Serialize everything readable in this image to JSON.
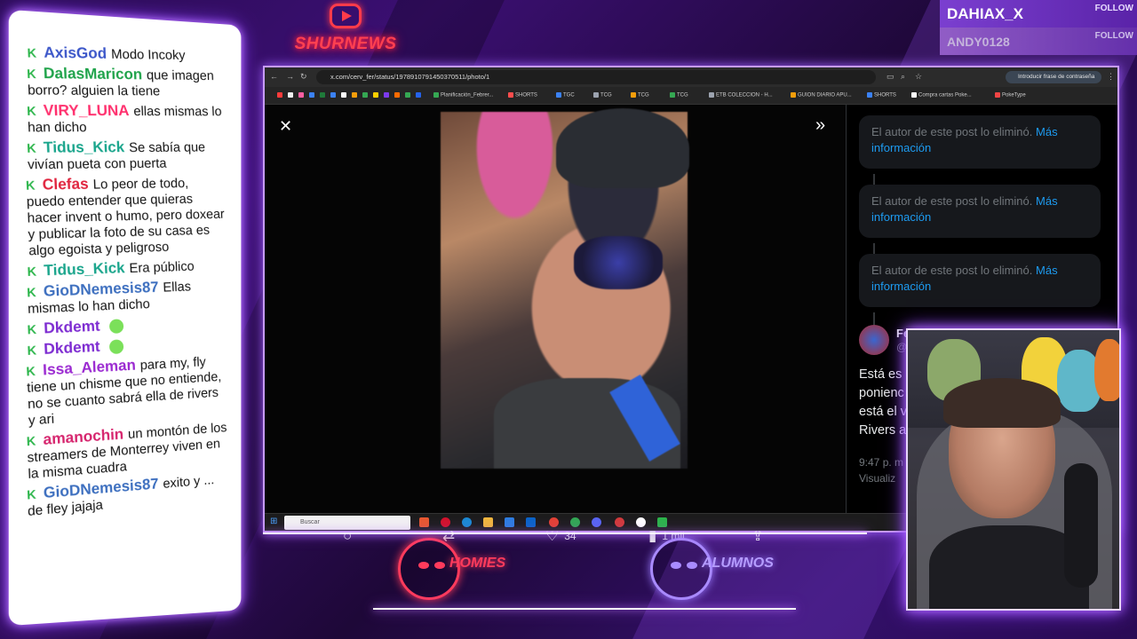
{
  "chat": {
    "messages": [
      {
        "user": "AxisGod",
        "color": "#3b56c9",
        "text": "Modo Incoky"
      },
      {
        "user": "DalasMaricon",
        "color": "#1fa34a",
        "text": "que imagen borro? alguien la tiene"
      },
      {
        "user": "VIRY_LUNA",
        "color": "#ff2f6d",
        "text": "ellas mismas lo han dicho"
      },
      {
        "user": "Tidus_Kick",
        "color": "#1aa58c",
        "text": "Se sabía que vivían pueta con puerta"
      },
      {
        "user": "Clefas",
        "color": "#e0243e",
        "text": "Lo peor de todo, puedo entender que quieras hacer invent o humo, pero doxear y publicar la foto de su casa es algo egoista y peligroso"
      },
      {
        "user": "Tidus_Kick",
        "color": "#1aa58c",
        "text": "Era público"
      },
      {
        "user": "GioDNemesis87",
        "color": "#3d6fbf",
        "text": "Ellas mismas lo han dicho"
      },
      {
        "user": "Dkdemt",
        "color": "#7d2bd1",
        "text": ""
      },
      {
        "user": "Dkdemt",
        "color": "#7d2bd1",
        "text": ""
      },
      {
        "user": "Issa_Aleman",
        "color": "#9b2ad1",
        "text": "para my, fly tiene un chisme que no entiende, no se cuanto sabrá ella de rivers y ari"
      },
      {
        "user": "amanochin",
        "color": "#d6246d",
        "text": "un montón de los streamers de Monterrey viven en la misma cuadra"
      },
      {
        "user": "GioDNemesis87",
        "color": "#3d6fbf",
        "text": "exito y ... de fley jajaja"
      }
    ],
    "kick_icon": "K"
  },
  "logo_top": {
    "text": "SHURNEWS",
    "icon": "youtube-play-icon"
  },
  "follows": [
    {
      "name": "DAHIAX_X",
      "tag": "FOLLOW"
    },
    {
      "name": "ANDY0128",
      "tag": "FOLLOW"
    }
  ],
  "browser": {
    "url": "x.com/cerv_fer/status/1978910791450370511/photo/1",
    "password_chip": "Introducir frase de contraseña",
    "bookmarks": [
      "Planificación_Febrer...",
      "SHORTS",
      "TGC",
      "TCG",
      "TCG",
      "TCG",
      "ETB COLECCION - H...",
      "GUION DIARIO APU...",
      "SHORTS",
      "Compra cartas Poke...",
      "PokeType"
    ]
  },
  "viewer": {
    "close_glyph": "✕",
    "expand_glyph": "»",
    "actions": {
      "reply_count": "",
      "retweet_count": "",
      "like_count": "34",
      "views_count": "1 mil"
    }
  },
  "side": {
    "deleted_notices": [
      {
        "text": "El autor de este post lo eliminó.",
        "more": "Más información"
      },
      {
        "text": "El autor de este post lo eliminó.",
        "more": "Más información"
      },
      {
        "text": "El autor de este post lo eliminó.",
        "more": "Más información"
      }
    ],
    "post": {
      "name": "Fe",
      "handle": "@",
      "text_lines": [
        "Está es l",
        "ponienc",
        "está el v",
        "Rivers a"
      ],
      "time": "9:47 p. m",
      "views": "Visualiz"
    }
  },
  "taskbar": {
    "search_placeholder": "Buscar"
  },
  "bottom_logos": [
    {
      "text": "HOMIES",
      "color": "#ff3b5c"
    },
    {
      "text": "ALUMNOS",
      "color": "#9b7bff"
    }
  ]
}
